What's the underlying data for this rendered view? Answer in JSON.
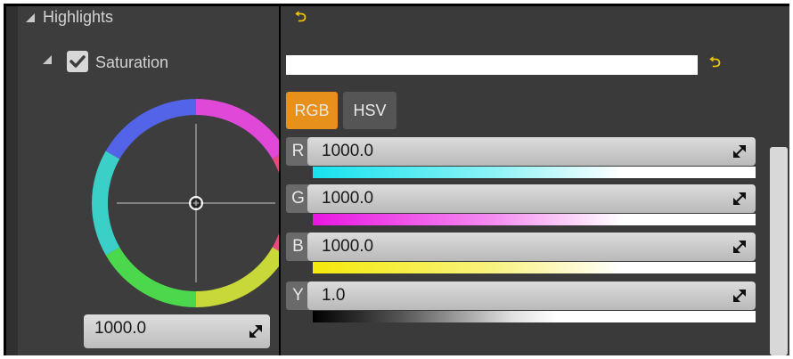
{
  "section": {
    "title": "Highlights"
  },
  "saturation": {
    "label": "Saturation",
    "checked": true,
    "value": "1000.0"
  },
  "mode_buttons": {
    "rgb": "RGB",
    "hsv": "HSV",
    "active": "RGB"
  },
  "channels": [
    {
      "letter": "R",
      "value": "1000.0",
      "color": "#26e6f0"
    },
    {
      "letter": "G",
      "value": "1000.0",
      "color": "#ee22e6"
    },
    {
      "letter": "B",
      "value": "1000.0",
      "color": "#f4ec14"
    },
    {
      "letter": "Y",
      "value": "1.0",
      "color": "#ffffff"
    }
  ],
  "colors": {
    "accent": "#e8901c",
    "reset_icon": "#f0c400",
    "panel": "#3a3a3a"
  },
  "icons": [
    "collapse-arrow-icon",
    "checkbox-icon",
    "reset-arrow-icon",
    "drag-arrow-icon",
    "crosshair-icon"
  ]
}
